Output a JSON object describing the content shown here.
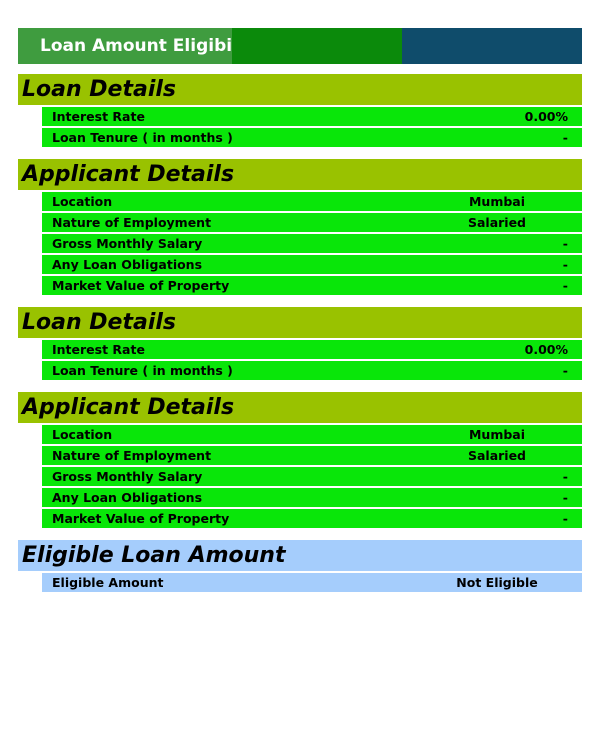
{
  "title": "Loan Amount Eligibility Calculator",
  "sections": [
    {
      "header": "Loan Details",
      "style": "green",
      "rows": [
        {
          "label": "Interest Rate",
          "value": "0.00%",
          "align": "right"
        },
        {
          "label": "Loan Tenure ( in months )",
          "value": "-",
          "align": "right"
        }
      ]
    },
    {
      "header": "Applicant Details",
      "style": "green",
      "rows": [
        {
          "label": "Location",
          "value": "Mumbai",
          "align": "center"
        },
        {
          "label": "Nature of Employment",
          "value": "Salaried",
          "align": "center"
        },
        {
          "label": "Gross Monthly Salary",
          "value": "-",
          "align": "right"
        },
        {
          "label": "Any Loan Obligations",
          "value": "-",
          "align": "right"
        },
        {
          "label": "Market Value of Property",
          "value": "-",
          "align": "right"
        }
      ]
    },
    {
      "header": "Loan Details",
      "style": "green",
      "rows": [
        {
          "label": "Interest Rate",
          "value": "0.00%",
          "align": "right"
        },
        {
          "label": "Loan Tenure ( in months )",
          "value": "-",
          "align": "right"
        }
      ]
    },
    {
      "header": "Applicant Details",
      "style": "green",
      "rows": [
        {
          "label": "Location",
          "value": "Mumbai",
          "align": "center"
        },
        {
          "label": "Nature of Employment",
          "value": "Salaried",
          "align": "center"
        },
        {
          "label": "Gross Monthly Salary",
          "value": "-",
          "align": "right"
        },
        {
          "label": "Any Loan Obligations",
          "value": "-",
          "align": "right"
        },
        {
          "label": "Market Value of Property",
          "value": "-",
          "align": "right"
        }
      ]
    },
    {
      "header": "Eligible Loan Amount",
      "style": "blue",
      "rows": [
        {
          "label": "Eligible Amount",
          "value": "Not Eligible",
          "align": "center"
        }
      ]
    }
  ]
}
